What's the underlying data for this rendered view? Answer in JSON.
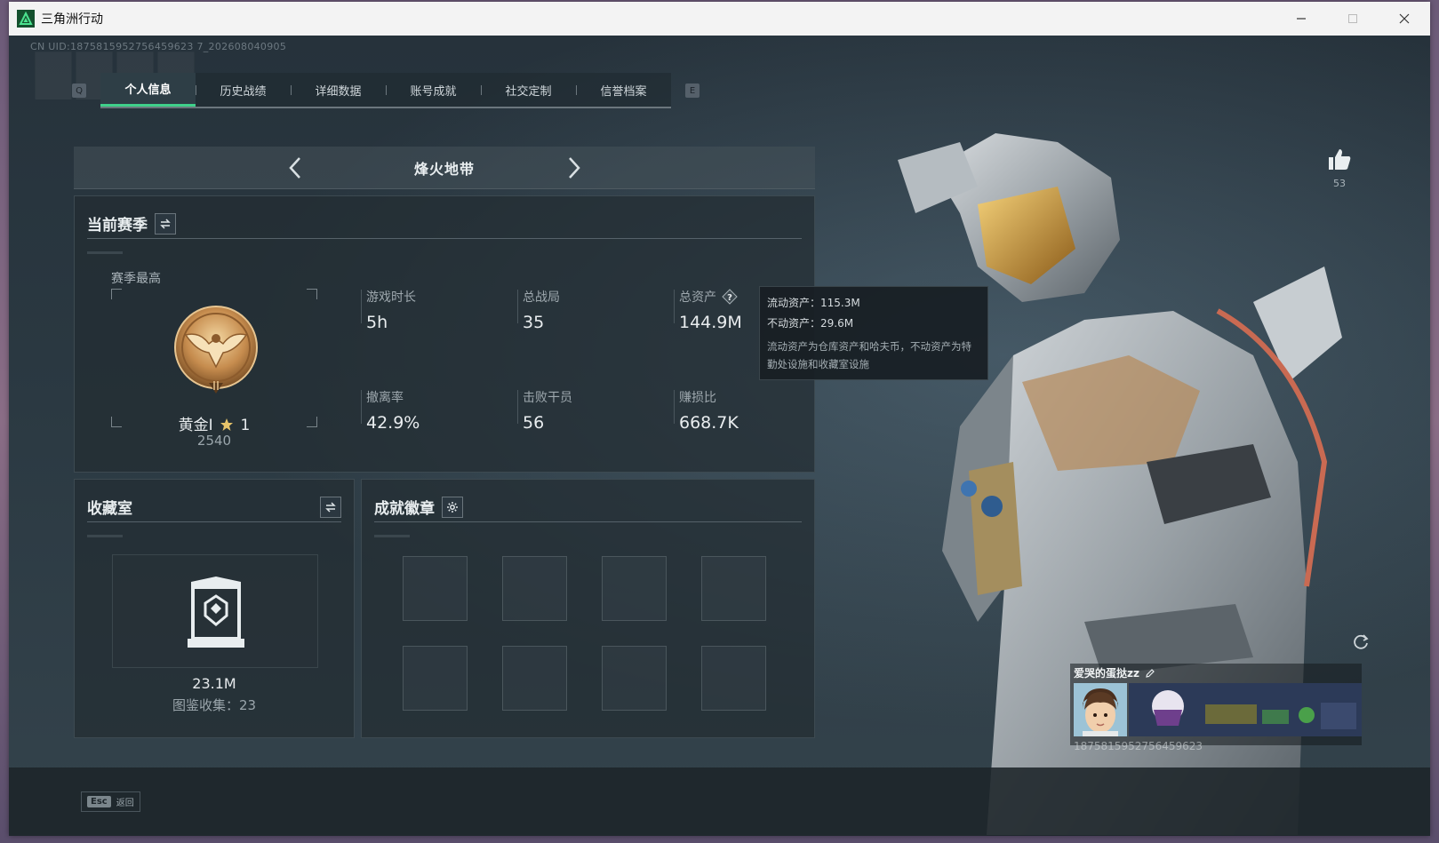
{
  "window": {
    "title": "三角洲行动"
  },
  "uid_line": "CN UID:1875815952756459623 7_202608040905",
  "tabs": {
    "key_left": "Q",
    "key_right": "E",
    "items": [
      {
        "label": "个人信息",
        "active": true
      },
      {
        "label": "历史战绩"
      },
      {
        "label": "详细数据"
      },
      {
        "label": "账号成就"
      },
      {
        "label": "社交定制"
      },
      {
        "label": "信誉档案"
      }
    ]
  },
  "mode": {
    "title": "烽火地带"
  },
  "season": {
    "title": "当前赛季",
    "best_label": "赛季最高",
    "rank_name": "黄金I",
    "rank_stars": "1",
    "rank_score": "2540",
    "stats": [
      {
        "label": "游戏时长",
        "value": "5h"
      },
      {
        "label": "总战局",
        "value": "35"
      },
      {
        "label": "总资产",
        "value": "144.9M"
      },
      {
        "label": "撤离率",
        "value": "42.9%"
      },
      {
        "label": "击败干员",
        "value": "56"
      },
      {
        "label": "赚损比",
        "value": "668.7K"
      }
    ]
  },
  "tooltip": {
    "liquid": "流动资产：115.3M",
    "fixed": "不动资产：29.6M",
    "desc": "流动资产为仓库资产和哈夫币，不动资产为特勤处设施和收藏室设施"
  },
  "collection": {
    "title": "收藏室",
    "value": "23.1M",
    "count": "图鉴收集：23"
  },
  "achievements": {
    "title": "成就徽章"
  },
  "like": {
    "count": "53"
  },
  "player": {
    "name": "爱哭的蛋挞zz",
    "uid": "1875815952756459623"
  },
  "footer": {
    "esc_key": "Esc",
    "esc_label": "返回"
  },
  "colors": {
    "accent": "#3fd08a",
    "bg": "#26323b"
  }
}
